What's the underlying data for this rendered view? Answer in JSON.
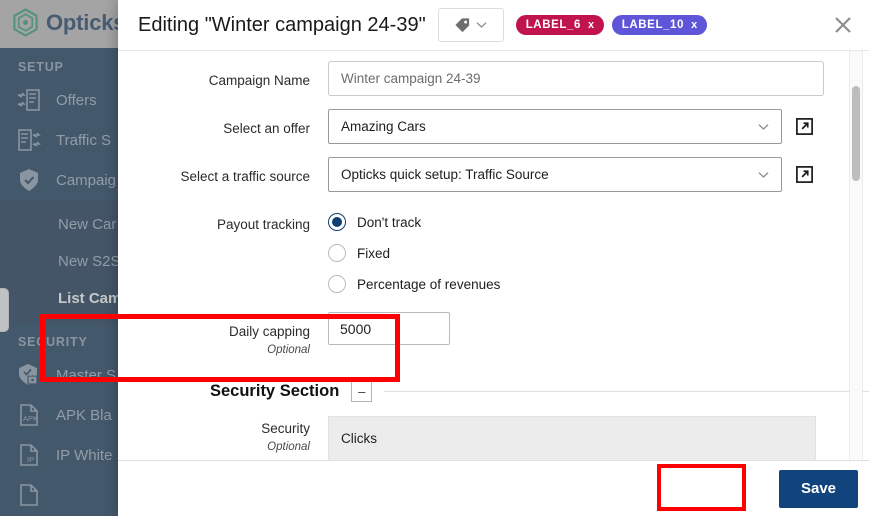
{
  "app": {
    "brand": "Opticks",
    "sidebar": {
      "sections": [
        {
          "title": "SETUP",
          "items": [
            {
              "label": "Offers",
              "icon": "offers-icon",
              "active": false
            },
            {
              "label": "Traffic S",
              "icon": "traffic-sources-icon",
              "active": false
            },
            {
              "label": "Campaig",
              "icon": "campaigns-shield-icon",
              "active": false
            }
          ],
          "subitems": [
            {
              "label": "New Car",
              "active": false
            },
            {
              "label": "New S2S",
              "active": false
            },
            {
              "label": "List Cam",
              "active": true
            }
          ]
        },
        {
          "title": "SECURITY",
          "items": [
            {
              "label": "Master S",
              "icon": "shield-lock-icon",
              "active": false
            },
            {
              "label": "APK Bla",
              "icon": "apk-file-icon",
              "active": false
            },
            {
              "label": "IP White",
              "icon": "ip-file-icon",
              "active": false
            }
          ],
          "subitems": []
        }
      ]
    }
  },
  "modal": {
    "title": "Editing \"Winter campaign 24-39\"",
    "tag_button": {
      "icon": "tag-icon",
      "chevron": "chevron-down-icon"
    },
    "labels": [
      {
        "text": "LABEL_6",
        "remove": "x",
        "color": "#C1134E"
      },
      {
        "text": "LABEL_10",
        "remove": "x",
        "color": "#5E55D8"
      }
    ],
    "close_icon": "close-icon",
    "form": {
      "campaign_name": {
        "label": "Campaign Name",
        "value": "Winter campaign 24-39",
        "placeholder": "Winter campaign 24-39"
      },
      "offer": {
        "label": "Select an offer",
        "value": "Amazing Cars",
        "chevron": "chevron-down-icon",
        "external": "external-link-icon"
      },
      "traffic_source": {
        "label": "Select a traffic source",
        "value": "Opticks quick setup: Traffic Source",
        "chevron": "chevron-down-icon",
        "external": "external-link-icon"
      },
      "payout_tracking": {
        "label": "Payout tracking",
        "options": [
          {
            "label": "Don't track",
            "selected": true
          },
          {
            "label": "Fixed",
            "selected": false
          },
          {
            "label": "Percentage of revenues",
            "selected": false
          }
        ]
      },
      "daily_capping": {
        "label": "Daily capping",
        "sublabel": "Optional",
        "value": "5000",
        "highlighted": true
      }
    },
    "security_section": {
      "title": "Security Section",
      "collapse_label": "–",
      "field": {
        "label": "Security",
        "sublabel": "Optional",
        "value": "Clicks"
      }
    },
    "footer": {
      "save_label": "Save"
    },
    "scrollbar": {
      "position": "top"
    }
  },
  "colors": {
    "brand_navy": "#11447c",
    "sidebar_navy": "#113558",
    "logo_green": "#2e9e7e",
    "highlight_red": "#FF0000",
    "label_6": "#C1134E",
    "label_10": "#5E55D8"
  }
}
